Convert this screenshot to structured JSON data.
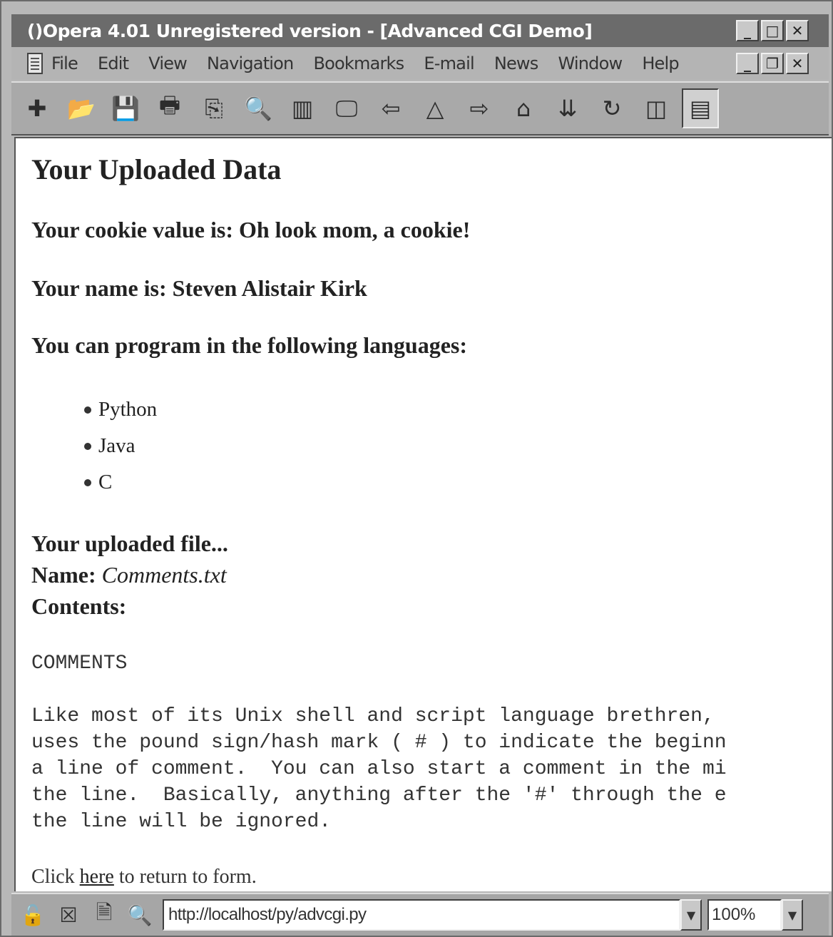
{
  "window": {
    "title": "()Opera 4.01 Unregistered version - [Advanced CGI Demo]",
    "controls": {
      "minimize": "_",
      "maximize": "□",
      "close": "✕",
      "restore": "❐"
    }
  },
  "menu": {
    "items": [
      "File",
      "Edit",
      "View",
      "Navigation",
      "Bookmarks",
      "E-mail",
      "News",
      "Window",
      "Help"
    ]
  },
  "toolbar": {
    "buttons": [
      {
        "icon": "new-page-icon",
        "glyph": "✚"
      },
      {
        "icon": "open-folder-icon",
        "glyph": "📂"
      },
      {
        "icon": "save-disk-icon",
        "glyph": "💾"
      },
      {
        "icon": "print-icon",
        "glyph": "🖶"
      },
      {
        "icon": "copy-icon",
        "glyph": "⎘"
      },
      {
        "icon": "find-icon",
        "glyph": "🔍"
      },
      {
        "icon": "hotlist-panel-icon",
        "glyph": "▥"
      },
      {
        "icon": "monitor-icon",
        "glyph": "🖵"
      },
      {
        "icon": "back-arrow-icon",
        "glyph": "⇦"
      },
      {
        "icon": "reload-triangle-icon",
        "glyph": "△"
      },
      {
        "icon": "forward-arrow-icon",
        "glyph": "⇨"
      },
      {
        "icon": "home-icon",
        "glyph": "⌂"
      },
      {
        "icon": "download-icon",
        "glyph": "⇊"
      },
      {
        "icon": "refresh-icon",
        "glyph": "↻"
      },
      {
        "icon": "tile-windows-icon",
        "glyph": "◫"
      },
      {
        "icon": "document-view-icon",
        "glyph": "▤"
      }
    ]
  },
  "page": {
    "heading": "Your Uploaded Data",
    "cookie_line": "Your cookie value is: Oh look mom, a cookie!",
    "name_line": "Your name is: Steven Alistair Kirk",
    "languages_line": "You can program in the following languages:",
    "languages": [
      "Python",
      "Java",
      "C"
    ],
    "file_heading": "Your uploaded file...",
    "file_name_label": "Name: ",
    "file_name": "Comments.txt",
    "contents_label": "Contents:",
    "file_title": "COMMENTS",
    "file_body": "Like most of its Unix shell and script language brethren, \nuses the pound sign/hash mark ( # ) to indicate the beginn\na line of comment.  You can also start a comment in the mi\nthe line.  Basically, anything after the '#' through the e\nthe line will be ignored.",
    "return_prefix": "Click ",
    "return_link": "here",
    "return_suffix": " to return to form."
  },
  "statusbar": {
    "address": "http://localhost/py/advcgi.py",
    "zoom": "100%"
  }
}
